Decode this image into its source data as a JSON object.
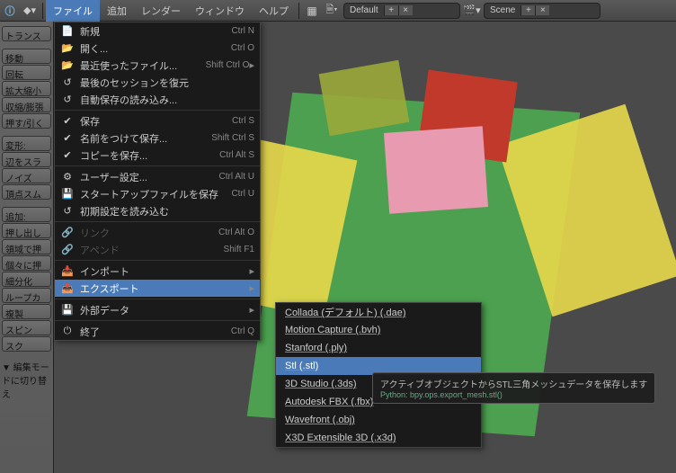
{
  "topbar": {
    "menus": [
      "ファイル",
      "追加",
      "レンダー",
      "ウィンドウ",
      "ヘルプ"
    ],
    "activeMenu": 0,
    "layoutField": "Default",
    "sceneField": "Scene"
  },
  "sidebar": {
    "groups": [
      [
        "トランス"
      ],
      [
        "移動",
        "回転",
        "拡大縮小",
        "収縮/膨張",
        "押す/引く"
      ],
      [
        "変形:",
        "辺をスラ",
        "ノイズ",
        "頂点スム"
      ],
      [
        "追加:",
        "押し出し",
        "領域で押",
        "個々に押",
        "細分化",
        "ループカ",
        "複製",
        "スピン",
        "スク"
      ]
    ],
    "footer": "▼ 編集モードに切り替え"
  },
  "fileMenu": {
    "items": [
      {
        "icon": "📄",
        "label": "新規",
        "shortcut": "Ctrl N"
      },
      {
        "icon": "📂",
        "label": "開く...",
        "shortcut": "Ctrl O"
      },
      {
        "icon": "📂",
        "label": "最近使ったファイル...",
        "shortcut": "Shift Ctrl O",
        "submenu": true
      },
      {
        "icon": "↺",
        "label": "最後のセッションを復元",
        "shortcut": ""
      },
      {
        "icon": "↺",
        "label": "自動保存の読み込み...",
        "shortcut": ""
      },
      {
        "sep": true
      },
      {
        "icon": "✔",
        "label": "保存",
        "shortcut": "Ctrl S"
      },
      {
        "icon": "✔",
        "label": "名前をつけて保存...",
        "shortcut": "Shift Ctrl S"
      },
      {
        "icon": "✔",
        "label": "コピーを保存...",
        "shortcut": "Ctrl Alt S"
      },
      {
        "sep": true
      },
      {
        "icon": "⚙",
        "label": "ユーザー設定...",
        "shortcut": "Ctrl Alt U"
      },
      {
        "icon": "💾",
        "label": "スタートアップファイルを保存",
        "shortcut": "Ctrl U"
      },
      {
        "icon": "↺",
        "label": "初期設定を読み込む",
        "shortcut": ""
      },
      {
        "sep": true
      },
      {
        "icon": "🔗",
        "label": "リンク",
        "shortcut": "Ctrl Alt O",
        "disabled": true
      },
      {
        "icon": "🔗",
        "label": "アペンド",
        "shortcut": "Shift F1",
        "disabled": true
      },
      {
        "sep": true
      },
      {
        "icon": "📥",
        "label": "インポート",
        "shortcut": "",
        "submenu": true
      },
      {
        "icon": "📤",
        "label": "エクスポート",
        "shortcut": "",
        "submenu": true,
        "highlighted": true
      },
      {
        "sep": true
      },
      {
        "icon": "💾",
        "label": "外部データ",
        "shortcut": "",
        "submenu": true
      },
      {
        "sep": true
      },
      {
        "icon": "⏻",
        "label": "終了",
        "shortcut": "Ctrl Q"
      }
    ]
  },
  "exportSubmenu": {
    "items": [
      {
        "label": "Collada (デフォルト) (.dae)"
      },
      {
        "label": "Motion Capture (.bvh)"
      },
      {
        "label": "Stanford (.ply)"
      },
      {
        "label": "Stl (.stl)",
        "highlighted": true
      },
      {
        "label": "3D Studio (.3ds)"
      },
      {
        "label": "Autodesk FBX (.fbx)"
      },
      {
        "label": "Wavefront (.obj)"
      },
      {
        "label": "X3D Extensible 3D (.x3d)"
      }
    ]
  },
  "tooltip": {
    "text": "アクティブオブジェクトからSTL三角メッシュデータを保存します",
    "python": "Python: bpy.ops.export_mesh.stl()"
  }
}
